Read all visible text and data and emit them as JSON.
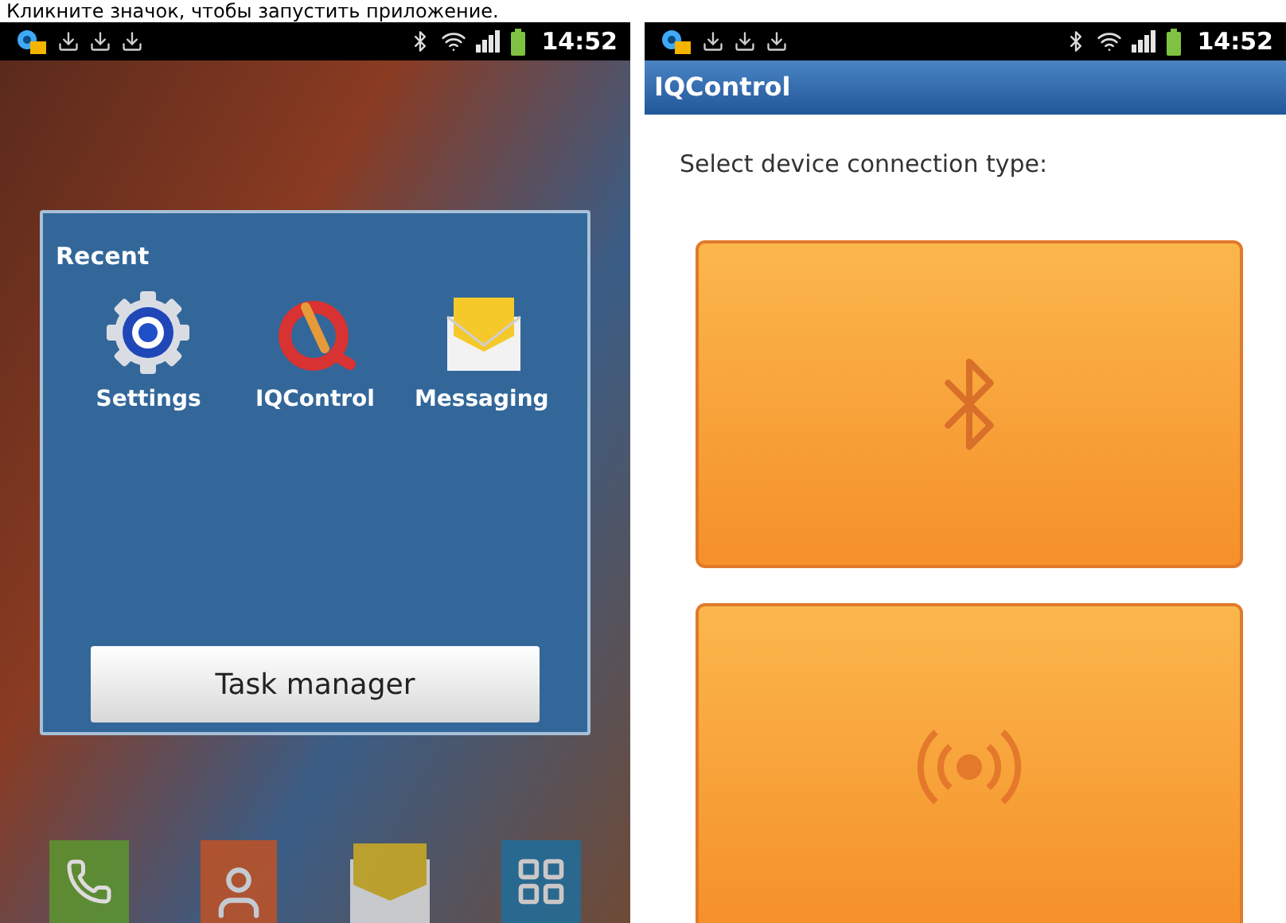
{
  "caption": "Кликните значок, чтобы запустить приложение.",
  "screens": [
    {
      "kind": "home",
      "status_bar": {
        "time": "14:52"
      },
      "recent_dialog": {
        "title": "Recent",
        "apps": [
          {
            "label": "Settings",
            "kind": "settings"
          },
          {
            "label": "IQControl",
            "kind": "iqcontrol"
          },
          {
            "label": "Messaging",
            "kind": "messaging"
          }
        ],
        "button": "Task manager"
      }
    },
    {
      "kind": "app",
      "status_bar": {
        "time": "14:52"
      },
      "title": "IQControl",
      "prompt": "Select device connection type:",
      "options": [
        {
          "kind": "bluetooth"
        },
        {
          "kind": "wireless"
        }
      ]
    }
  ]
}
